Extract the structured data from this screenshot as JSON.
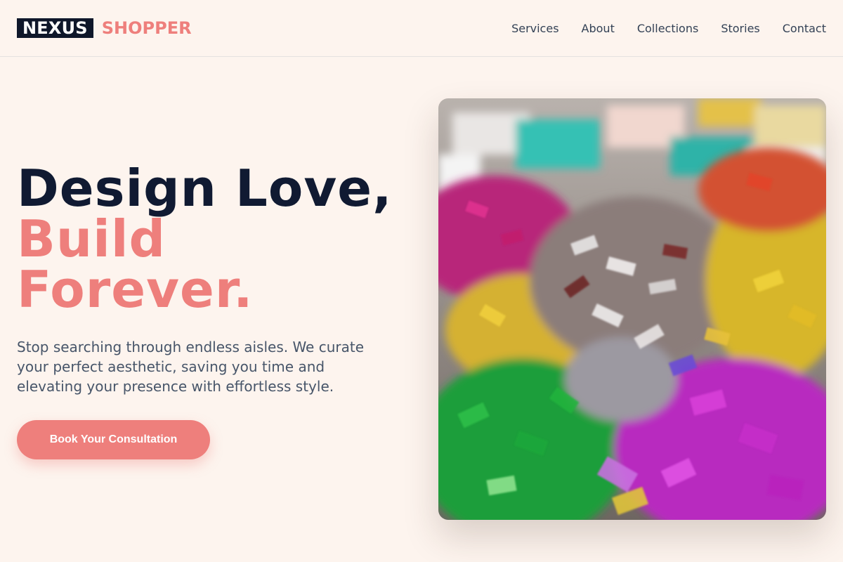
{
  "brand": {
    "box_text": "NEXUS",
    "name": "SHOPPER"
  },
  "nav": [
    "Services",
    "About",
    "Collections",
    "Stories",
    "Contact"
  ],
  "hero": {
    "line1": "Design Love,",
    "line2": "Build",
    "line3": "Forever.",
    "lead": "Stop searching through endless aisles. We curate your perfect aesthetic, saving you time and elevating your presence with effortless style.",
    "cta": "Book Your Consultation"
  },
  "colors": {
    "accent": "#ee7f7c",
    "dark": "#0f172a",
    "background": "#fdf4ee"
  }
}
